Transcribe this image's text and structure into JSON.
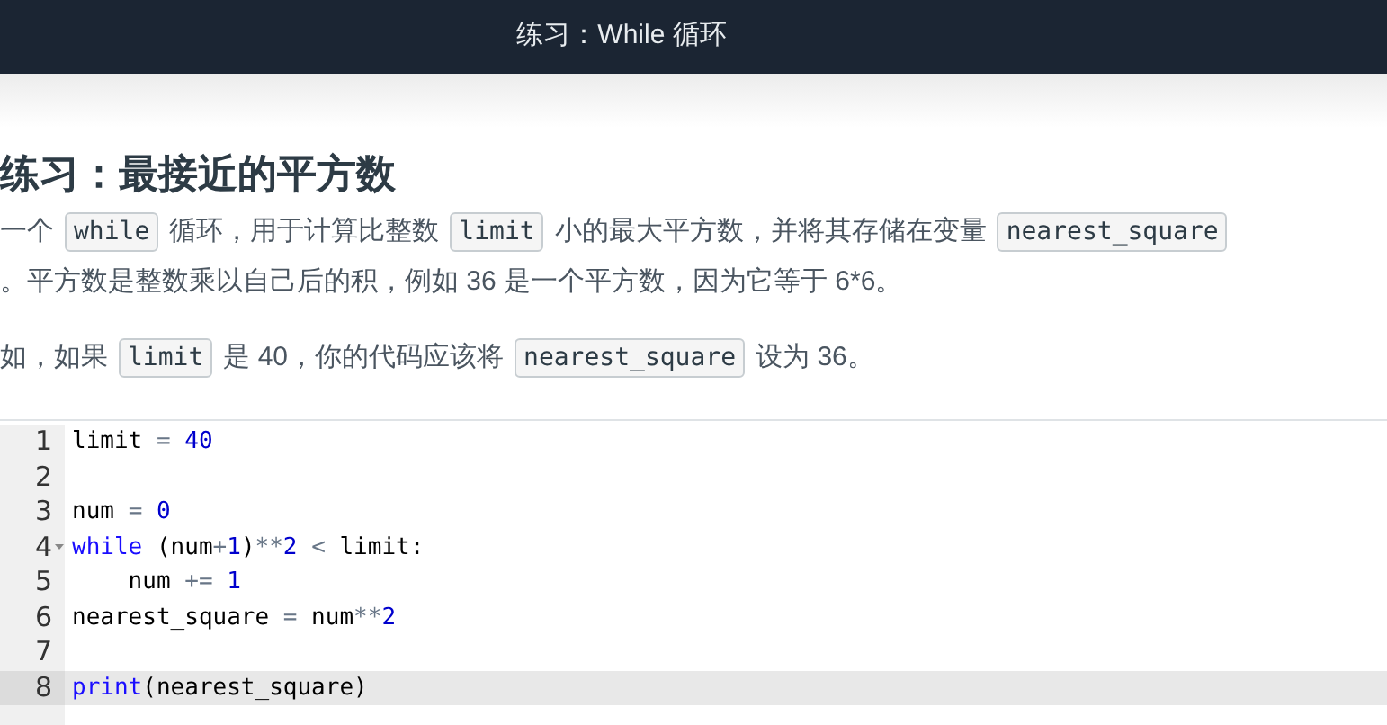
{
  "header": {
    "title": "练习：While 循环"
  },
  "heading": "练习：最接近的平方数",
  "paragraphs": [
    {
      "lines": [
        [
          {
            "kind": "text",
            "text": "一个"
          },
          {
            "kind": "code",
            "text": "while"
          },
          {
            "kind": "text",
            "text": "循环，用于计算比整数"
          },
          {
            "kind": "code",
            "text": "limit"
          },
          {
            "kind": "text",
            "text": "小的最大平方数，并将其存储在变量"
          },
          {
            "kind": "code",
            "text": "nearest_square"
          }
        ],
        [
          {
            "kind": "text",
            "text": "。平方数是整数乘以自己后的积，例如 36 是一个平方数，因为它等于 6*6。"
          }
        ]
      ]
    },
    {
      "lines": [
        [
          {
            "kind": "text",
            "text": "如，如果"
          },
          {
            "kind": "code",
            "text": "limit"
          },
          {
            "kind": "text",
            "text": "是 40，你的代码应该将"
          },
          {
            "kind": "code",
            "text": "nearest_square"
          },
          {
            "kind": "text",
            "text": "设为 36。"
          }
        ]
      ]
    }
  ],
  "editor": {
    "lines": [
      {
        "number": "1",
        "active": false,
        "foldable": false,
        "tokens": [
          {
            "kind": "name",
            "text": "limit "
          },
          {
            "kind": "op",
            "text": "="
          },
          {
            "kind": "num",
            "text": " 40"
          }
        ]
      },
      {
        "number": "2",
        "active": false,
        "foldable": false
      },
      {
        "number": "3",
        "active": false,
        "foldable": false,
        "tokens": [
          {
            "kind": "name",
            "text": "num "
          },
          {
            "kind": "op",
            "text": "="
          },
          {
            "kind": "num",
            "text": " 0"
          }
        ]
      },
      {
        "number": "4",
        "active": false,
        "foldable": true,
        "tokens": [
          {
            "kind": "keyword",
            "text": "while"
          },
          {
            "kind": "name",
            "text": " (num"
          },
          {
            "kind": "op",
            "text": "+"
          },
          {
            "kind": "num",
            "text": "1"
          },
          {
            "kind": "name",
            "text": ")"
          },
          {
            "kind": "op",
            "text": "**"
          },
          {
            "kind": "num",
            "text": "2"
          },
          {
            "kind": "op",
            "text": " <"
          },
          {
            "kind": "name",
            "text": " limit:"
          }
        ]
      },
      {
        "number": "5",
        "active": false,
        "foldable": false,
        "tokens": [
          {
            "kind": "name",
            "text": "    num "
          },
          {
            "kind": "op",
            "text": "+="
          },
          {
            "kind": "num",
            "text": " 1"
          }
        ]
      },
      {
        "number": "6",
        "active": false,
        "foldable": false,
        "tokens": [
          {
            "kind": "name",
            "text": "nearest_square "
          },
          {
            "kind": "op",
            "text": "="
          },
          {
            "kind": "name",
            "text": " num"
          },
          {
            "kind": "op",
            "text": "**"
          },
          {
            "kind": "num",
            "text": "2"
          }
        ]
      },
      {
        "number": "7",
        "active": false,
        "foldable": false
      },
      {
        "number": "8",
        "active": true,
        "foldable": false,
        "tokens": [
          {
            "kind": "keyword",
            "text": "print"
          },
          {
            "kind": "name",
            "text": "(nearest_square)"
          }
        ]
      }
    ]
  }
}
